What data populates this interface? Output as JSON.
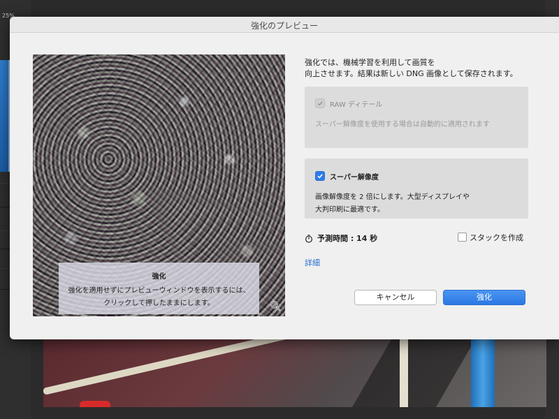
{
  "app": {
    "zoom_label": "25%"
  },
  "dialog": {
    "title": "強化のプレビュー",
    "description_line1": "強化では、機械学習を利用して画質を",
    "description_line2": "向上させます。結果は新しい DNG 画像として保存されます。",
    "raw_details": {
      "label": "RAW ディテール",
      "checked": true,
      "enabled": false,
      "description": "スーパー解像度を使用する場合は自動的に適用されます"
    },
    "super_resolution": {
      "label": "スーパー解像度",
      "checked": true,
      "description_line1": "画像解像度を 2 倍にします。大型ディスプレイや",
      "description_line2": "大判印刷に最適です。"
    },
    "estimated_time": "予測時間 : 14 秒",
    "stack": {
      "label": "スタックを作成",
      "checked": false
    },
    "details_link": "詳細",
    "cancel_button": "キャンセル",
    "enhance_button": "強化",
    "preview_overlay": {
      "title": "強化",
      "line1": "強化を適用せずにプレビューウィンドウを表示するには、",
      "line2": "クリックして押したままにします。"
    }
  },
  "colors": {
    "accent": "#2e7be8",
    "link": "#2a6fd0",
    "dialog_bg": "#f0f0f0",
    "panel_bg": "#dcdcdc"
  },
  "icons": [
    "zoom-magnifier-icon",
    "timer-icon",
    "checkmark-icon"
  ]
}
